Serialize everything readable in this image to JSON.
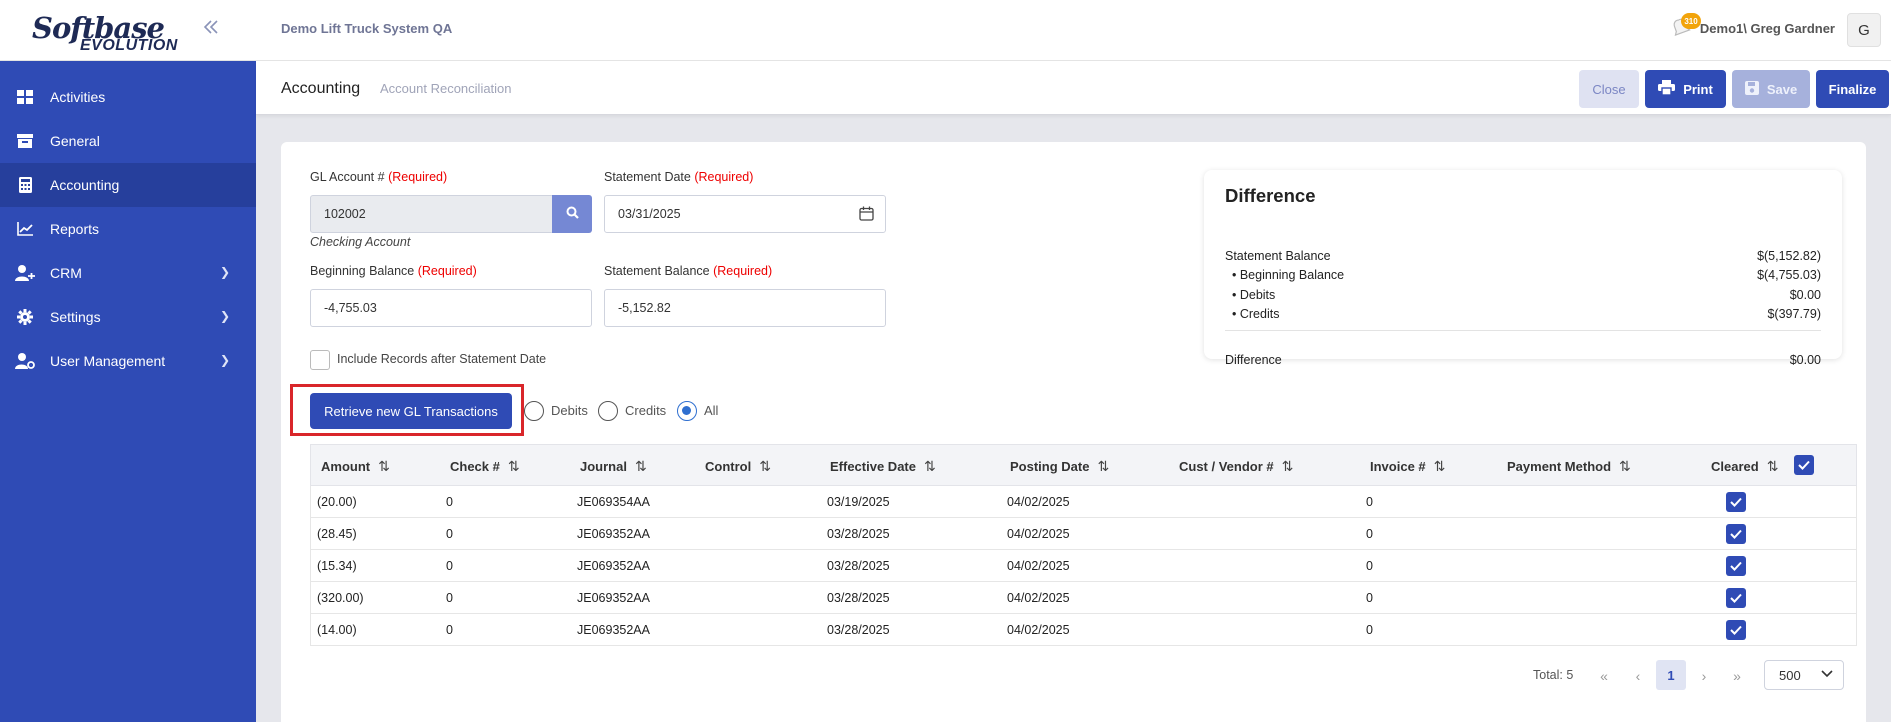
{
  "brand": {
    "logo_line1": "Softbase",
    "logo_line2": "EVOLUTION"
  },
  "sidebar": {
    "items": [
      {
        "label": "Activities",
        "icon": "grid-icon"
      },
      {
        "label": "General",
        "icon": "archive-icon"
      },
      {
        "label": "Accounting",
        "icon": "calculator-icon",
        "active": true
      },
      {
        "label": "Reports",
        "icon": "chart-icon"
      },
      {
        "label": "CRM",
        "icon": "users-icon",
        "has_submenu": true
      },
      {
        "label": "Settings",
        "icon": "gear-icon",
        "has_submenu": true
      },
      {
        "label": "User Management",
        "icon": "user-cog-icon",
        "has_submenu": true
      }
    ]
  },
  "topbar": {
    "system_name": "Demo Lift Truck System QA",
    "notification_count": "310",
    "user_name": "Demo1\\ Greg Gardner",
    "avatar_initial": "G"
  },
  "header": {
    "title": "Accounting",
    "breadcrumb": "Account Reconciliation",
    "buttons": {
      "close": "Close",
      "print": "Print",
      "save": "Save",
      "finalize": "Finalize"
    }
  },
  "form": {
    "required_text": "(Required)",
    "gl_account_label": "GL Account #",
    "gl_account_value": "102002",
    "gl_account_name": "Checking Account",
    "statement_date_label": "Statement Date",
    "statement_date_value": "03/31/2025",
    "beginning_balance_label": "Beginning Balance",
    "beginning_balance_value": "-4,755.03",
    "statement_balance_label": "Statement Balance",
    "statement_balance_value": "-5,152.82",
    "include_records_label": "Include Records after Statement Date"
  },
  "difference": {
    "title": "Difference",
    "rows": [
      {
        "label": "Statement Balance",
        "value": "$(5,152.82)"
      },
      {
        "label": "• Beginning Balance",
        "value": "$(4,755.03)"
      },
      {
        "label": "• Debits",
        "value": "$0.00"
      },
      {
        "label": "• Credits",
        "value": "$(397.79)"
      }
    ],
    "total_label": "Difference",
    "total_value": "$0.00"
  },
  "filters": {
    "retrieve_label": "Retrieve new GL Transactions",
    "debits": "Debits",
    "credits": "Credits",
    "all": "All",
    "selected": "All"
  },
  "table": {
    "columns": [
      "Amount",
      "Check #",
      "Journal",
      "Control",
      "Effective Date",
      "Posting Date",
      "Cust / Vendor #",
      "Invoice #",
      "Payment Method",
      "Cleared"
    ],
    "rows": [
      {
        "amount": "(20.00)",
        "check": "0",
        "journal": "JE069354AA",
        "control": "",
        "effective": "03/19/2025",
        "posting": "04/02/2025",
        "cust": "",
        "invoice": "0",
        "payment": "",
        "cleared": true
      },
      {
        "amount": "(28.45)",
        "check": "0",
        "journal": "JE069352AA",
        "control": "",
        "effective": "03/28/2025",
        "posting": "04/02/2025",
        "cust": "",
        "invoice": "0",
        "payment": "",
        "cleared": true
      },
      {
        "amount": "(15.34)",
        "check": "0",
        "journal": "JE069352AA",
        "control": "",
        "effective": "03/28/2025",
        "posting": "04/02/2025",
        "cust": "",
        "invoice": "0",
        "payment": "",
        "cleared": true
      },
      {
        "amount": "(320.00)",
        "check": "0",
        "journal": "JE069352AA",
        "control": "",
        "effective": "03/28/2025",
        "posting": "04/02/2025",
        "cust": "",
        "invoice": "0",
        "payment": "",
        "cleared": true
      },
      {
        "amount": "(14.00)",
        "check": "0",
        "journal": "JE069352AA",
        "control": "",
        "effective": "03/28/2025",
        "posting": "04/02/2025",
        "cust": "",
        "invoice": "0",
        "payment": "",
        "cleared": true
      }
    ]
  },
  "pagination": {
    "total_text": "Total: 5",
    "current_page": "1",
    "page_size": "500"
  },
  "colors": {
    "primary": "#2f4bb5",
    "sidebar": "#2f4bb5",
    "required": "#ee0000",
    "highlight_box": "#d9262a"
  }
}
